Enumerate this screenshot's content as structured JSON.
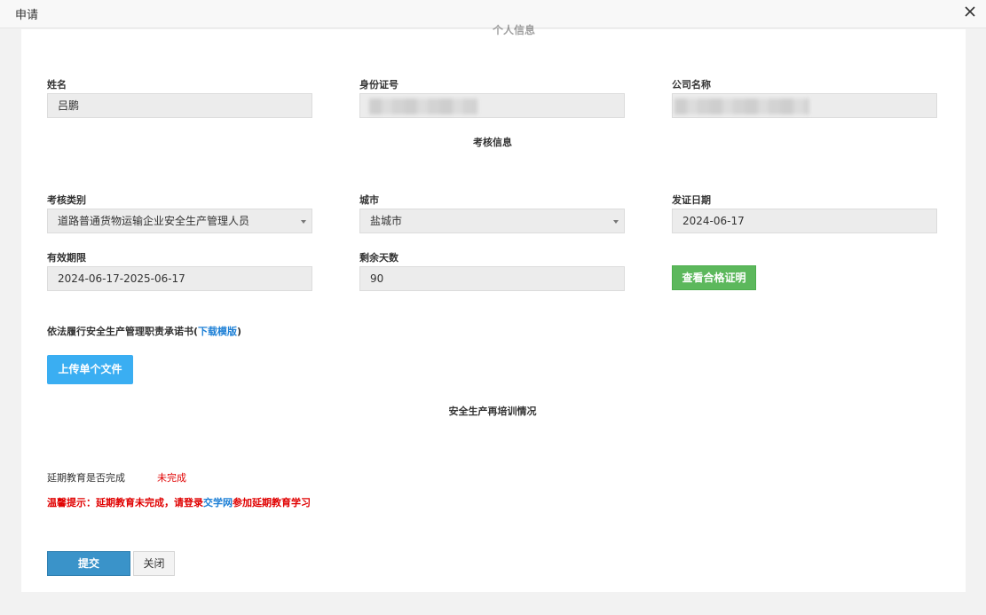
{
  "dialog": {
    "title": "申请",
    "close_icon": "close-icon"
  },
  "basic": {
    "name_label": "姓名",
    "name_value": "吕鹏",
    "id_label": "身份证号",
    "id_value": "",
    "company_label": "公司名称",
    "company_value": ""
  },
  "assessment": {
    "heading": "考核信息",
    "category_label": "考核类别",
    "category_value": "道路普通货物运输企业安全生产管理人员",
    "city_label": "城市",
    "city_value": "盐城市",
    "issue_date_label": "发证日期",
    "issue_date_value": "2024-06-17",
    "validity_label": "有效期限",
    "validity_value": "2024-06-17-2025-06-17",
    "remaining_label": "剩余天数",
    "remaining_value": "90",
    "view_certificate_button": "查看合格证明"
  },
  "commitment": {
    "text_before": "依法履行安全生产管理职责承诺书(",
    "download_link": "下载模版",
    "text_after": ")",
    "upload_button": "上传单个文件"
  },
  "retraining": {
    "heading": "安全生产再培训情况",
    "status_label": "延期教育是否完成",
    "status_value": "未完成",
    "tip_before": "温馨提示：延期教育未完成，请登录",
    "tip_link": "交学网",
    "tip_after": "参加延期教育学习"
  },
  "actions": {
    "submit": "提交",
    "close": "关闭"
  },
  "colors": {
    "accent_blue": "#3aaef2",
    "submit_blue": "#3a93c9",
    "success_green": "#5cb85c",
    "warning_red": "#e00000",
    "link_blue": "#1e80d6"
  }
}
